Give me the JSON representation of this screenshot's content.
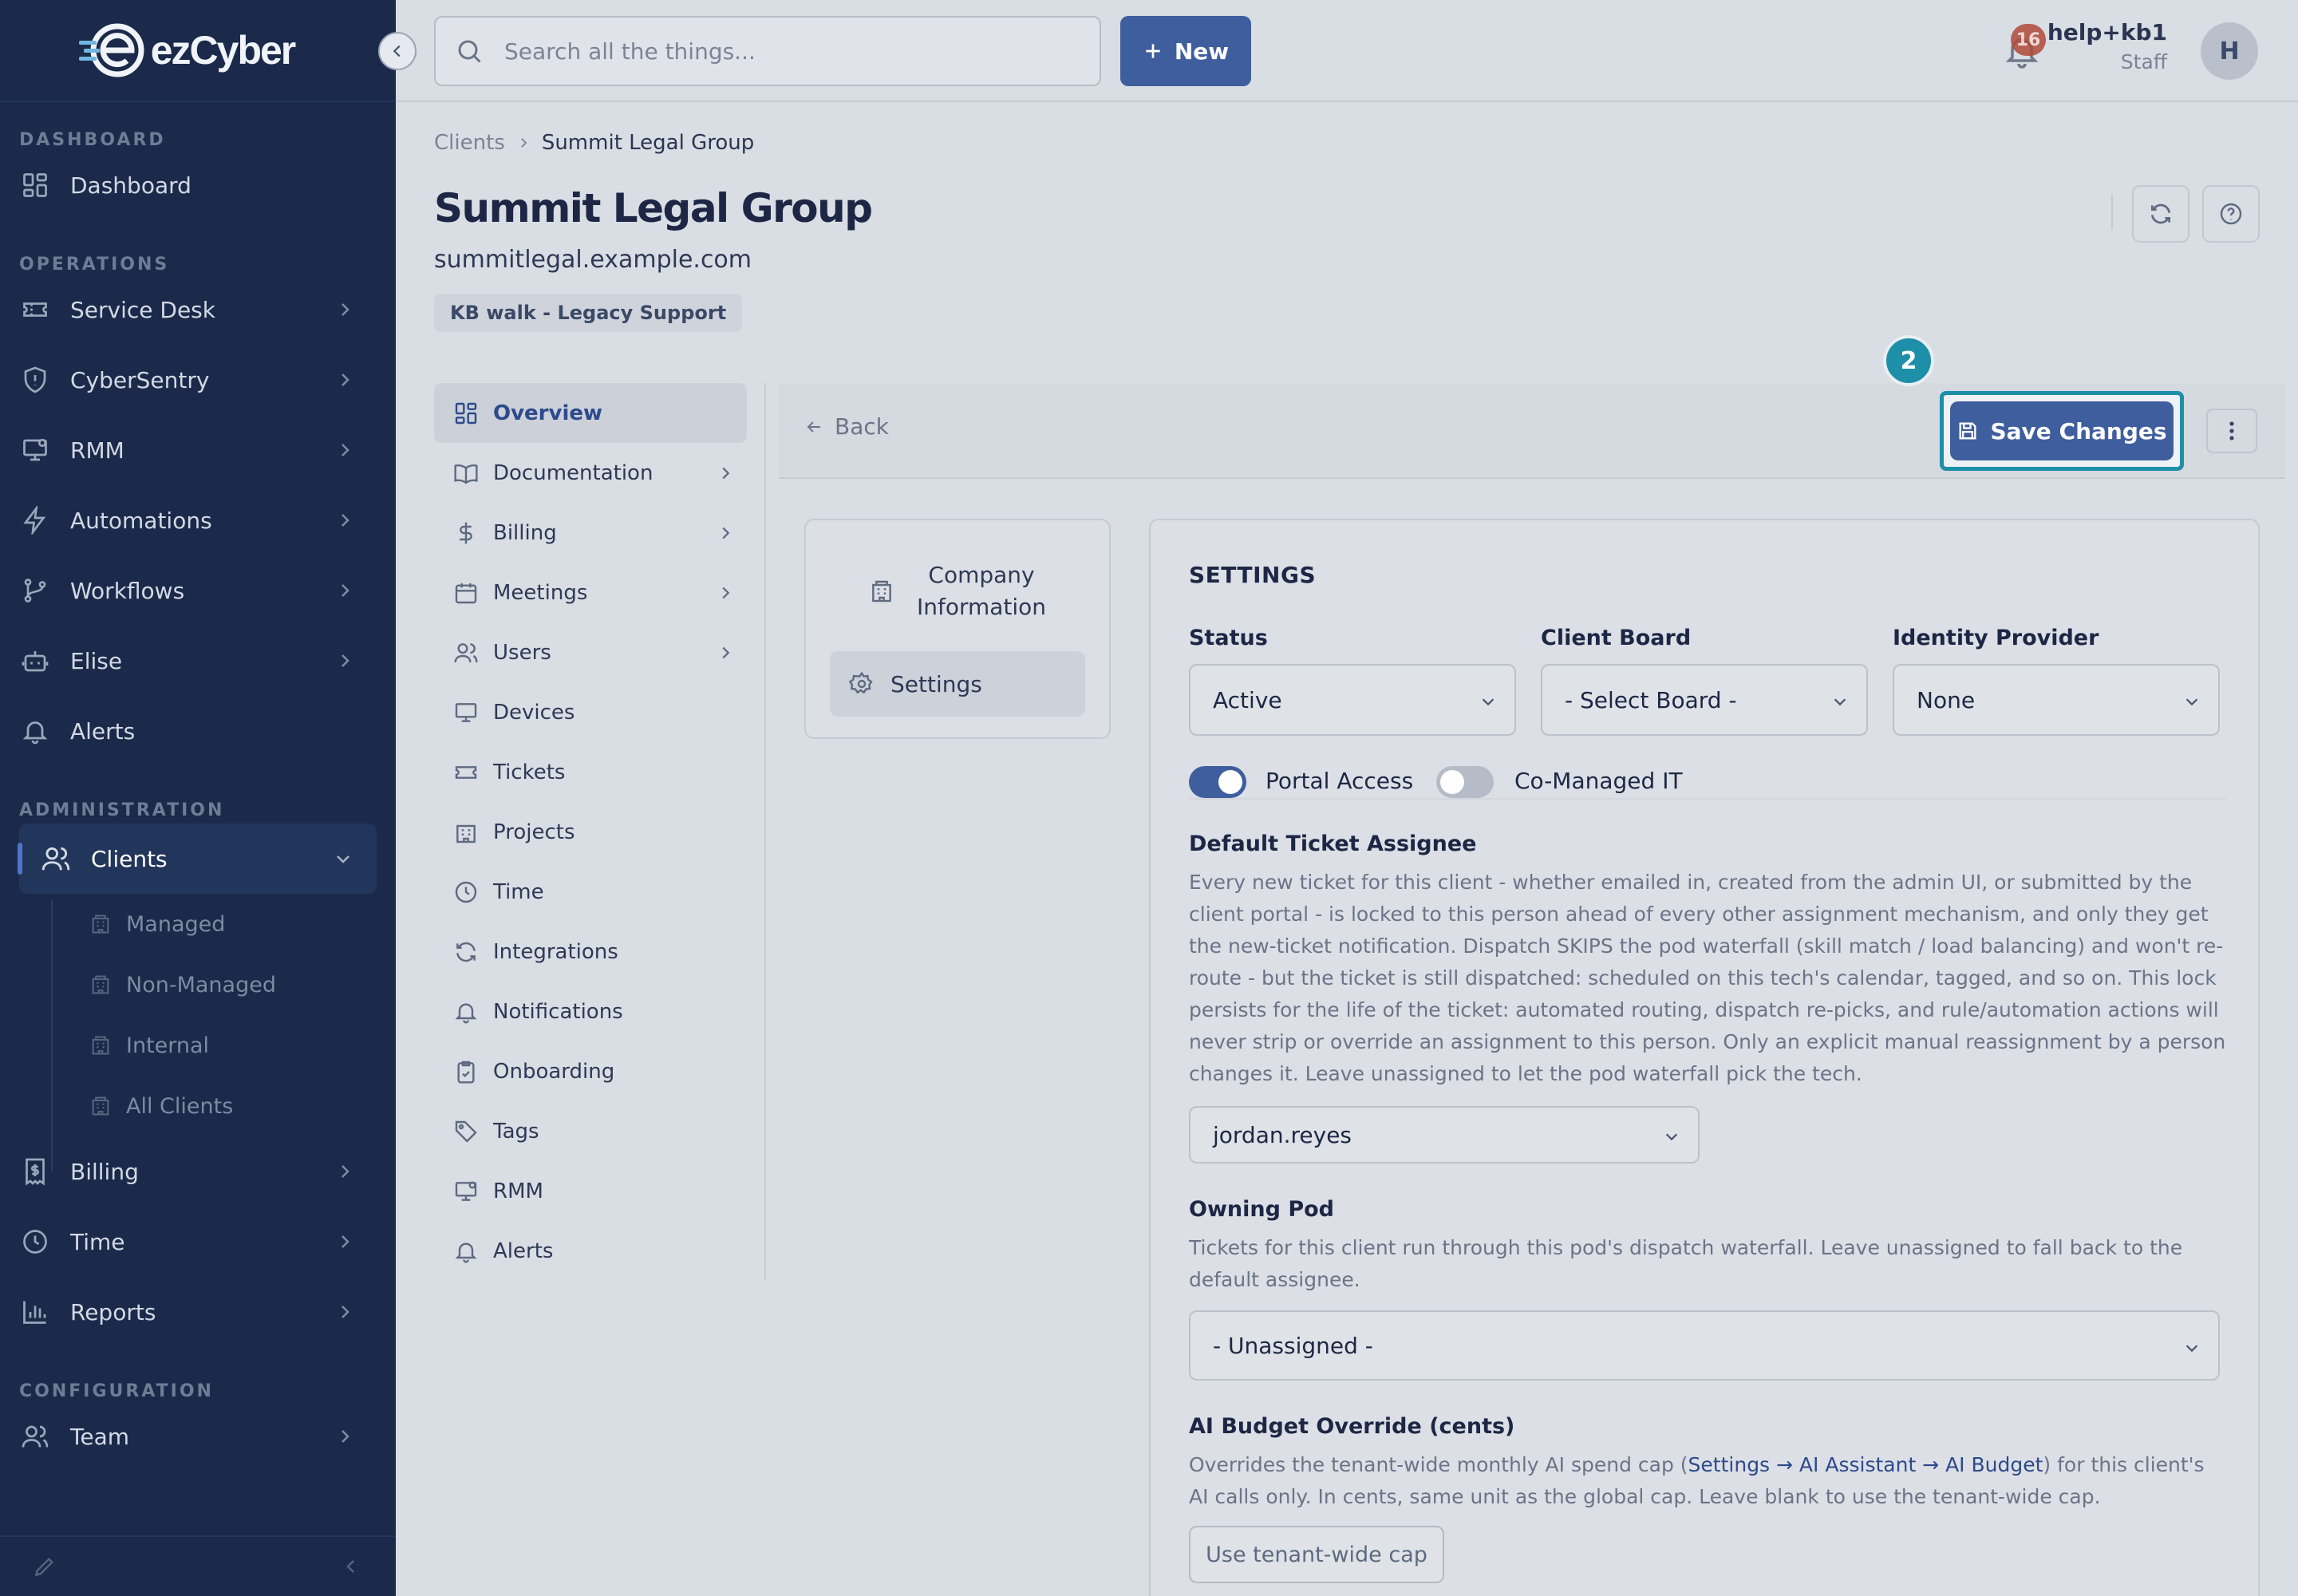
{
  "brand": {
    "name": "ezCyber"
  },
  "colors": {
    "sidebar_bg": "#1b2a4a",
    "primary": "#3f5e9e",
    "highlight": "#1d8fa8",
    "page_bg": "#d9dde4"
  },
  "sidebar": {
    "sections": [
      {
        "heading": "DASHBOARD",
        "items": [
          {
            "label": "Dashboard",
            "icon": "dashboard-icon",
            "has_chevron": false
          }
        ]
      },
      {
        "heading": "OPERATIONS",
        "items": [
          {
            "label": "Service Desk",
            "icon": "ticket-icon",
            "has_chevron": true
          },
          {
            "label": "CyberSentry",
            "icon": "shield-icon",
            "has_chevron": true
          },
          {
            "label": "RMM",
            "icon": "monitor-icon",
            "has_chevron": true
          },
          {
            "label": "Automations",
            "icon": "bolt-icon",
            "has_chevron": true
          },
          {
            "label": "Workflows",
            "icon": "branch-icon",
            "has_chevron": true
          },
          {
            "label": "Elise",
            "icon": "robot-icon",
            "has_chevron": true
          },
          {
            "label": "Alerts",
            "icon": "bell-icon",
            "has_chevron": false
          }
        ]
      },
      {
        "heading": "ADMINISTRATION",
        "items": [
          {
            "label": "Clients",
            "icon": "users-icon",
            "active": true,
            "expanded": true,
            "children": [
              "Managed",
              "Non-Managed",
              "Internal",
              "All Clients"
            ]
          },
          {
            "label": "Billing",
            "icon": "invoice-icon",
            "has_chevron": true
          },
          {
            "label": "Time",
            "icon": "clock-icon",
            "has_chevron": true
          },
          {
            "label": "Reports",
            "icon": "bar-chart-icon",
            "has_chevron": true
          }
        ]
      },
      {
        "heading": "CONFIGURATION",
        "items": [
          {
            "label": "Team",
            "icon": "users-icon",
            "has_chevron": true
          }
        ]
      }
    ]
  },
  "topbar": {
    "search_placeholder": "Search all the things...",
    "new_label": "New",
    "notification_count": "16",
    "user_name": "help+kb1",
    "user_role": "Staff",
    "avatar_initial": "H"
  },
  "page": {
    "breadcrumb": [
      "Clients",
      "Summit Legal Group"
    ],
    "title": "Summit Legal Group",
    "domain": "summitlegal.example.com",
    "tag": "KB walk - Legacy Support"
  },
  "subnav": [
    {
      "label": "Overview",
      "icon": "dashboard-icon",
      "active": true,
      "has_chevron": false
    },
    {
      "label": "Documentation",
      "icon": "book-icon",
      "has_chevron": true
    },
    {
      "label": "Billing",
      "icon": "dollar-icon",
      "has_chevron": true
    },
    {
      "label": "Meetings",
      "icon": "calendar-icon",
      "has_chevron": true
    },
    {
      "label": "Users",
      "icon": "users-icon",
      "has_chevron": true
    },
    {
      "label": "Devices",
      "icon": "monitor-icon",
      "has_chevron": false
    },
    {
      "label": "Tickets",
      "icon": "ticket-icon",
      "has_chevron": false
    },
    {
      "label": "Projects",
      "icon": "building-icon",
      "has_chevron": false
    },
    {
      "label": "Time",
      "icon": "clock-icon",
      "has_chevron": false
    },
    {
      "label": "Integrations",
      "icon": "refresh-icon",
      "has_chevron": false
    },
    {
      "label": "Notifications",
      "icon": "bell-icon",
      "has_chevron": false
    },
    {
      "label": "Onboarding",
      "icon": "clipboard-icon",
      "has_chevron": false
    },
    {
      "label": "Tags",
      "icon": "tag-icon",
      "has_chevron": false
    },
    {
      "label": "RMM",
      "icon": "monitor-icon",
      "has_chevron": false
    },
    {
      "label": "Alerts",
      "icon": "bell-icon",
      "has_chevron": false
    }
  ],
  "actionbar": {
    "back_label": "Back",
    "save_label": "Save Changes",
    "step_number": "2"
  },
  "settings_nav": {
    "company_line1": "Company",
    "company_line2": "Information",
    "settings_label": "Settings"
  },
  "settings": {
    "section_title": "SETTINGS",
    "status": {
      "label": "Status",
      "value": "Active"
    },
    "client_board": {
      "label": "Client Board",
      "value": "- Select Board -"
    },
    "identity_provider": {
      "label": "Identity Provider",
      "value": "None"
    },
    "portal_access": {
      "label": "Portal Access",
      "on": true
    },
    "co_managed": {
      "label": "Co-Managed IT",
      "on": false
    },
    "default_assignee": {
      "label": "Default Ticket Assignee",
      "help": "Every new ticket for this client - whether emailed in, created from the admin UI, or submitted by the client portal - is locked to this person ahead of every other assignment mechanism, and only they get the new-ticket notification. Dispatch SKIPS the pod waterfall (skill match / load balancing) and won't re-route - but the ticket is still dispatched: scheduled on this tech's calendar, tagged, and so on. This lock persists for the life of the ticket: automated routing, dispatch re-picks, and rule/automation actions will never strip or override an assignment to this person. Only an explicit manual reassignment by a person changes it. Leave unassigned to let the pod waterfall pick the tech.",
      "value": "jordan.reyes"
    },
    "owning_pod": {
      "label": "Owning Pod",
      "help": "Tickets for this client run through this pod's dispatch waterfall. Leave unassigned to fall back to the default assignee.",
      "value": "- Unassigned -"
    },
    "ai_budget": {
      "label": "AI Budget Override (cents)",
      "help_before": "Overrides the tenant-wide monthly AI spend cap (",
      "help_link": "Settings → AI Assistant → AI Budget",
      "help_after": ") for this client's AI calls only. In cents, same unit as the global cap. Leave blank to use the tenant-wide cap.",
      "button": "Use tenant-wide cap"
    }
  }
}
